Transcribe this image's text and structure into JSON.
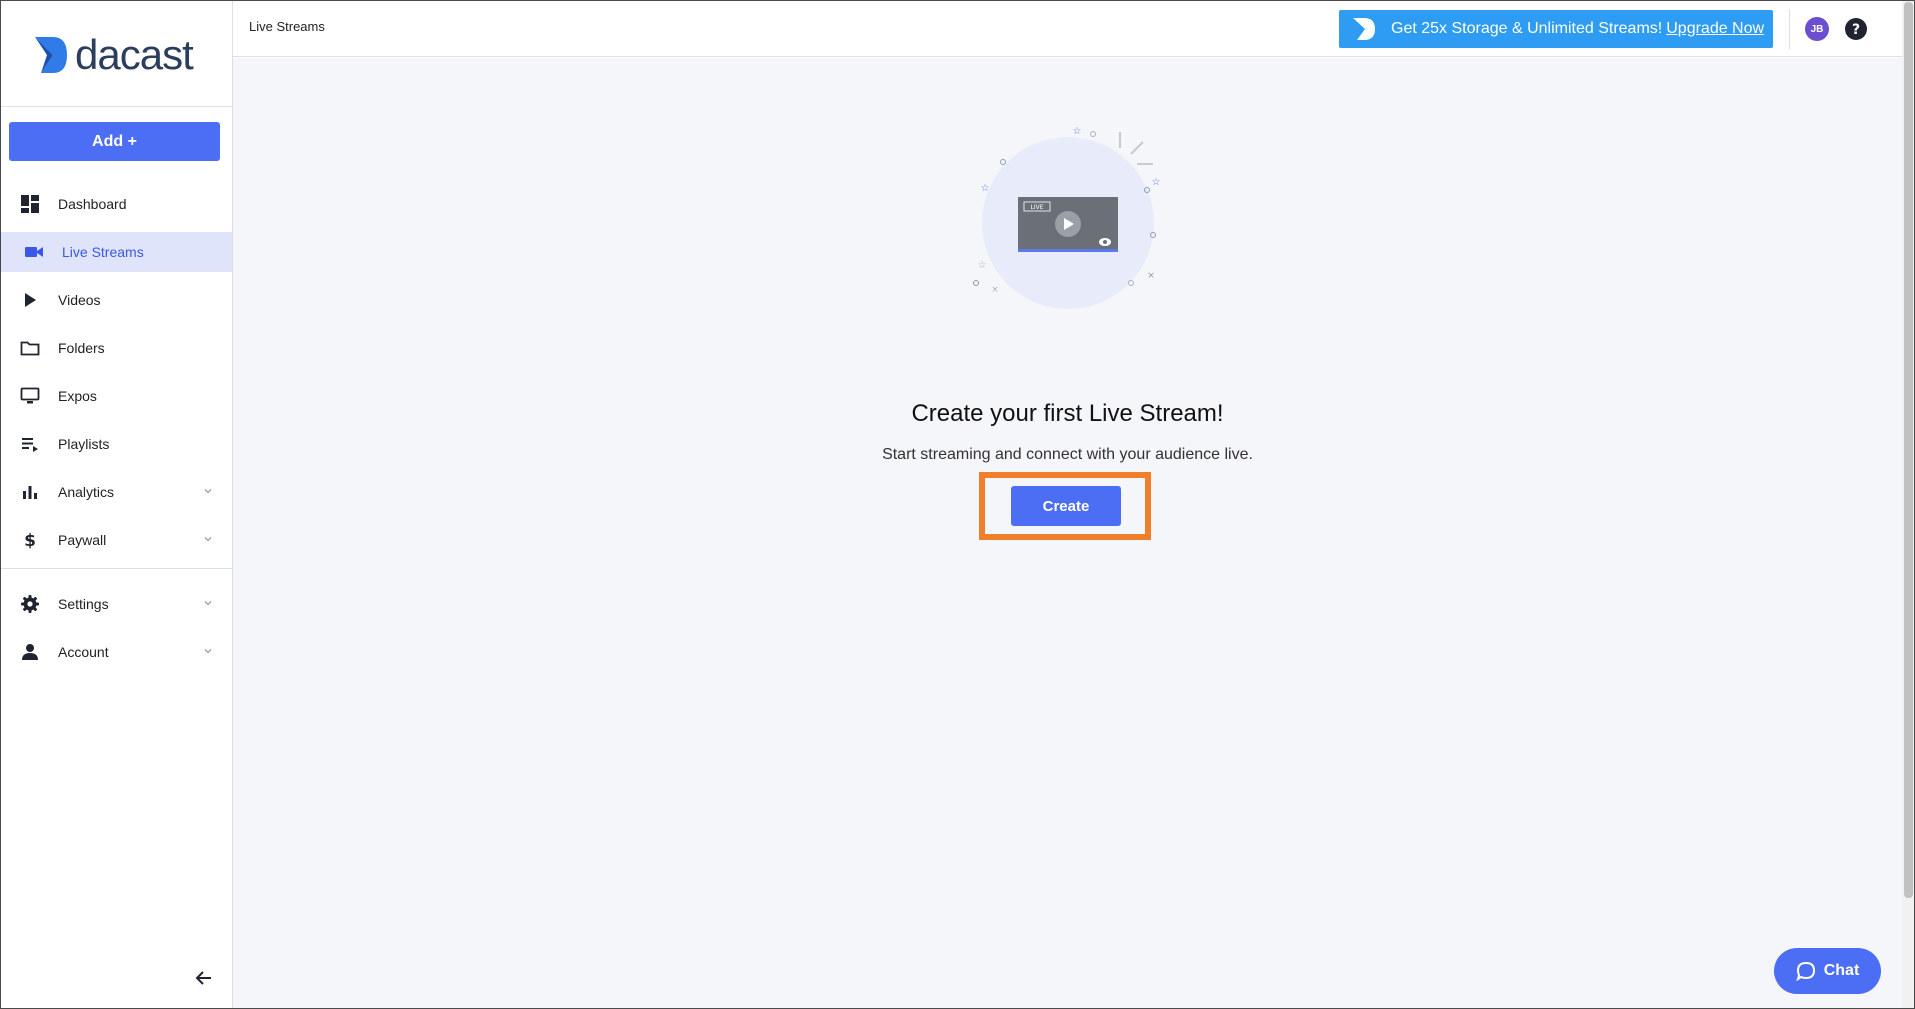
{
  "app": {
    "logo_text": "dacast"
  },
  "sidebar": {
    "add_label": "Add +",
    "items": [
      {
        "label": "Dashboard",
        "icon": "dashboard-icon"
      },
      {
        "label": "Live Streams",
        "icon": "video-camera-icon",
        "active": true
      },
      {
        "label": "Videos",
        "icon": "play-icon"
      },
      {
        "label": "Folders",
        "icon": "folder-icon"
      },
      {
        "label": "Expos",
        "icon": "monitor-icon"
      },
      {
        "label": "Playlists",
        "icon": "playlist-icon"
      },
      {
        "label": "Analytics",
        "icon": "bar-chart-icon",
        "expandable": true
      },
      {
        "label": "Paywall",
        "icon": "dollar-icon",
        "expandable": true
      }
    ],
    "bottom_items": [
      {
        "label": "Settings",
        "icon": "gear-icon",
        "expandable": true
      },
      {
        "label": "Account",
        "icon": "person-icon",
        "expandable": true
      }
    ]
  },
  "header": {
    "breadcrumb": "Live Streams",
    "promo_text": "Get 25x Storage & Unlimited Streams!",
    "promo_link": "Upgrade Now",
    "avatar_initials": "JB"
  },
  "main": {
    "illustration_badge": "LIVE",
    "title": "Create your first Live Stream!",
    "subtitle": "Start streaming and connect with your audience live.",
    "create_label": "Create"
  },
  "chat": {
    "label": "Chat"
  },
  "colors": {
    "accent": "#4c6ef5",
    "promo": "#2d9cf2",
    "highlight": "#ef7f2b",
    "active_bg": "#dfe4fa",
    "avatar": "#6c4fd1"
  }
}
